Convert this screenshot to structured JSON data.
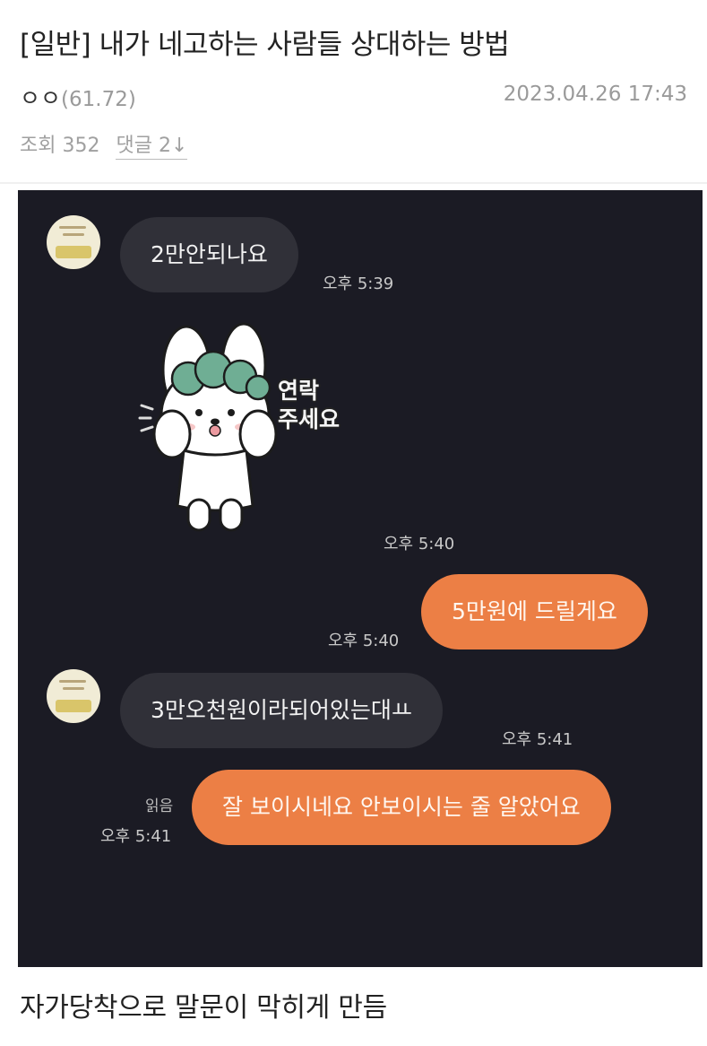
{
  "post": {
    "title": "[일반] 내가 네고하는 사람들 상대하는 방법",
    "author_name": "ㅇㅇ",
    "author_score": "(61.72)",
    "date": "2023.04.26 17:43",
    "views": "조회 352",
    "comments": "댓글 2↓"
  },
  "chat": {
    "messages": [
      {
        "text": "2만안되나요",
        "time": "오후 5:39"
      },
      {
        "time": "오후 5:40"
      },
      {
        "text": "5만원에 드릴게요",
        "time": "오후 5:40"
      },
      {
        "text": "3만오천원이라되어있는대ㅛ",
        "time": "오후 5:41"
      },
      {
        "text": "잘 보이시네요 안보이시는 줄 알았어요",
        "time": "오후 5:41",
        "read": "읽음"
      }
    ],
    "sticker": {
      "line1": "연락",
      "line2": "주세요"
    }
  },
  "caption": "자가당착으로 말문이 막히게 만듬",
  "colors": {
    "chat_background": "#1b1b24",
    "incoming_bubble": "#303038",
    "outgoing_bubble": "#ec7f45"
  },
  "icons": [
    "profile-avatar",
    "bunny-sticker"
  ]
}
